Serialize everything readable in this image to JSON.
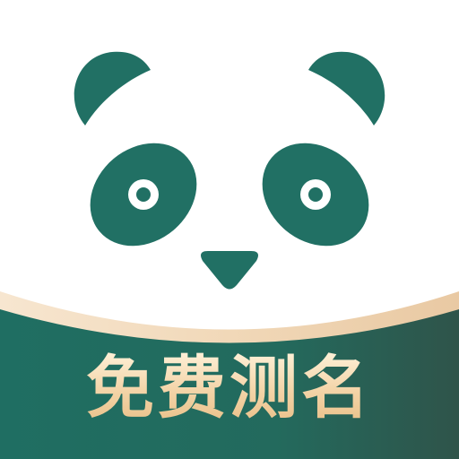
{
  "banner": {
    "text": "免费测名"
  },
  "colors": {
    "panda_green": "#217064",
    "banner_green_start": "#1f6e62",
    "banner_green_end": "#2f544a",
    "banner_trim_light": "#f7e6d0",
    "banner_trim_dark": "#e9c9a3",
    "text_light": "#fff3dc",
    "text_dark": "#e8be86",
    "background": "#ffffff"
  },
  "icons": [
    "panda-face-icon",
    "panda-ear-icon",
    "panda-eye-icon",
    "panda-nose-icon"
  ]
}
